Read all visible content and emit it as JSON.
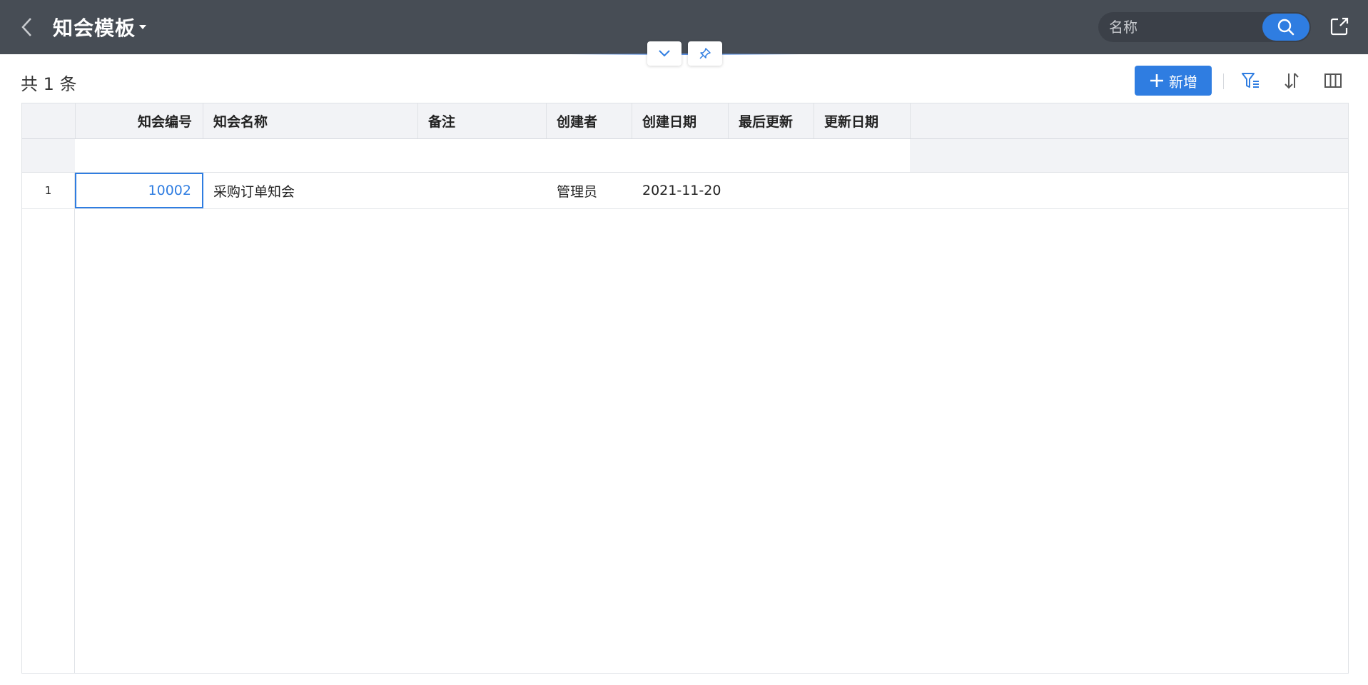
{
  "header": {
    "title": "知会模板",
    "search_placeholder": "名称"
  },
  "toolbar": {
    "count_label": "共 1 条",
    "add_label": "新增"
  },
  "table": {
    "columns": [
      "知会编号",
      "知会名称",
      "备注",
      "创建者",
      "创建日期",
      "最后更新",
      "更新日期"
    ],
    "rows": [
      {
        "index": "1",
        "code": "10002",
        "name": "采购订单知会",
        "remark": "",
        "creator": "管理员",
        "created_date": "2021-11-20",
        "last_updater": "",
        "updated_date": ""
      }
    ]
  },
  "colors": {
    "header_bg": "#474d55",
    "accent": "#2f7de1",
    "grid_head_bg": "#f2f3f6"
  },
  "icons": [
    "chevron-left-icon",
    "caret-down-icon",
    "search-icon",
    "share-icon",
    "chevron-down-icon",
    "pin-icon",
    "plus-icon",
    "filter-icon",
    "sort-icon",
    "columns-icon"
  ]
}
